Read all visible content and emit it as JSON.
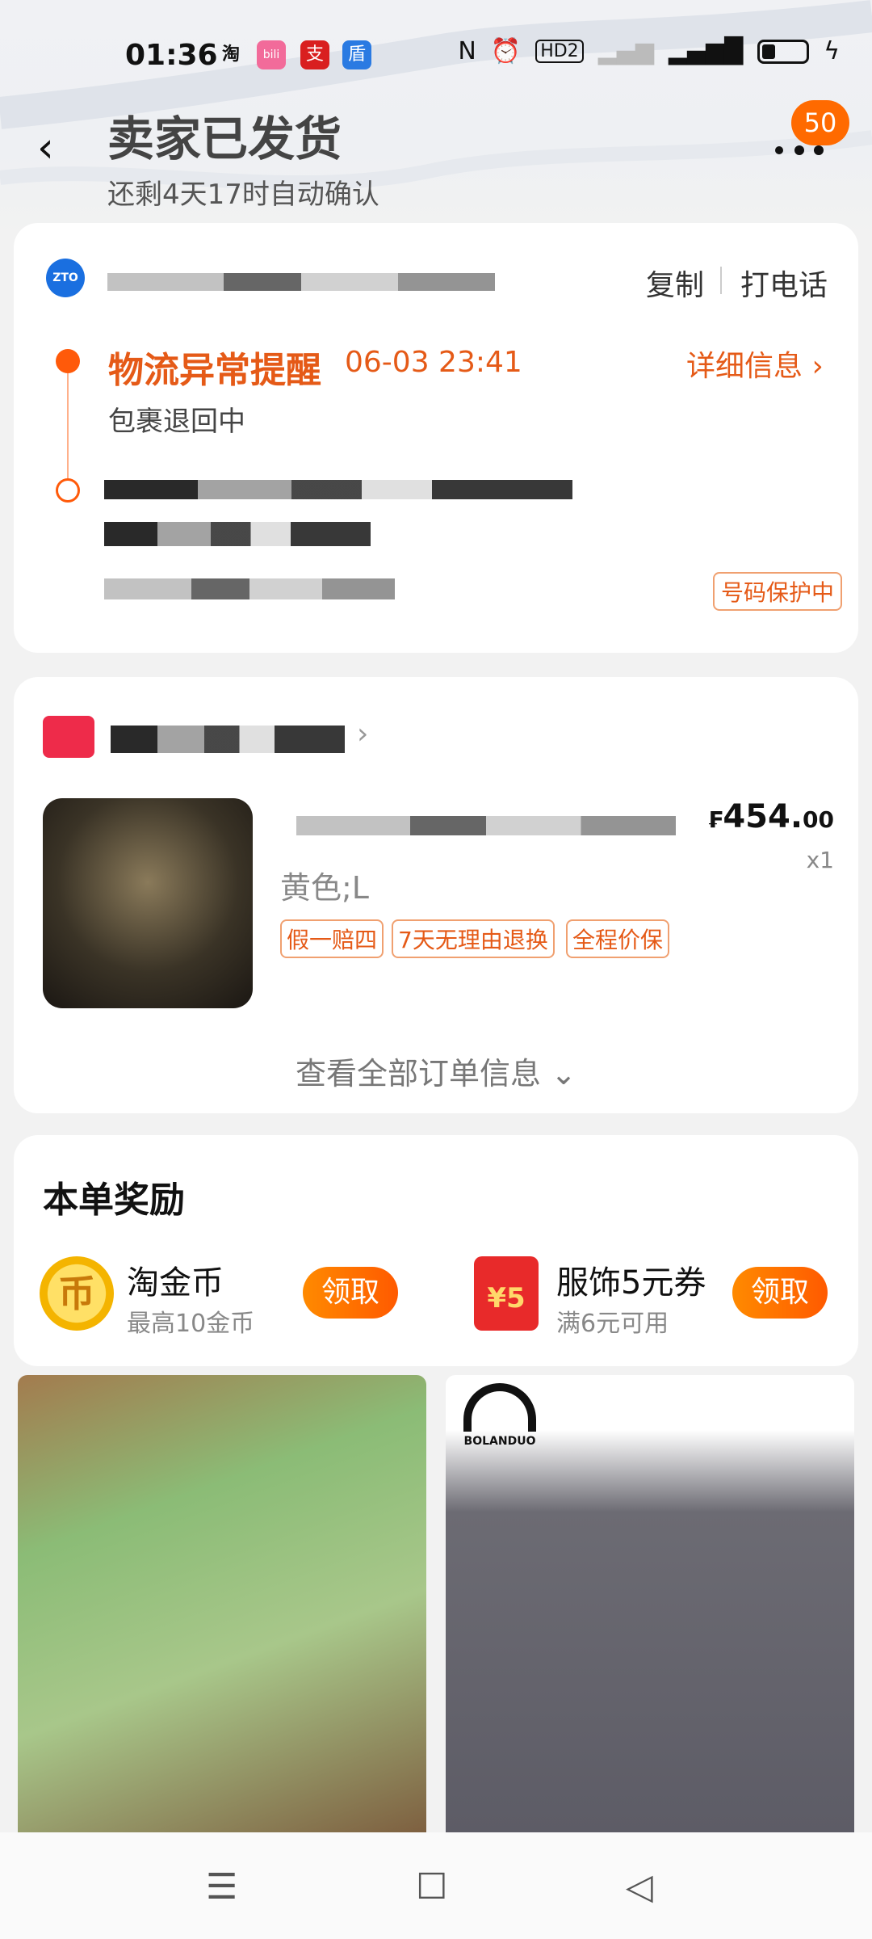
{
  "status_bar": {
    "time": "01:36",
    "apps": [
      "淘",
      "bili",
      "支",
      "盾"
    ],
    "indicators": [
      "NFC",
      "alarm",
      "HD2",
      "4G"
    ]
  },
  "header": {
    "title": "卖家已发货",
    "subtitle": "还剩4天17时自动确认",
    "badge": "50"
  },
  "logistics": {
    "copy": "复制",
    "call": "打电话",
    "alert_title": "物流异常提醒",
    "alert_time": "06-03 23:41",
    "detail": "详细信息",
    "status": "包裹退回中",
    "protect_tag": "号码保护中"
  },
  "order": {
    "price_symbol": "₣",
    "price_int": "454.",
    "price_dec": "00",
    "qty": "x1",
    "sku": "黄色;L",
    "tags": [
      "假一赔四",
      "7天无理由退换",
      "全程价保"
    ],
    "view_all": "查看全部订单信息"
  },
  "rewards": {
    "title": "本单奖励",
    "coin_icon": "币",
    "items": [
      {
        "name": "淘金币",
        "sub": "最高10金币",
        "button": "领取"
      },
      {
        "name": "服饰5元券",
        "sub": "满6元可用",
        "button": "领取"
      }
    ],
    "coupon_text": "¥5"
  },
  "recommend": {
    "brand": "BOLANDUO"
  },
  "navbar": {
    "menu": "☰",
    "home": "☐",
    "back": "◁"
  }
}
